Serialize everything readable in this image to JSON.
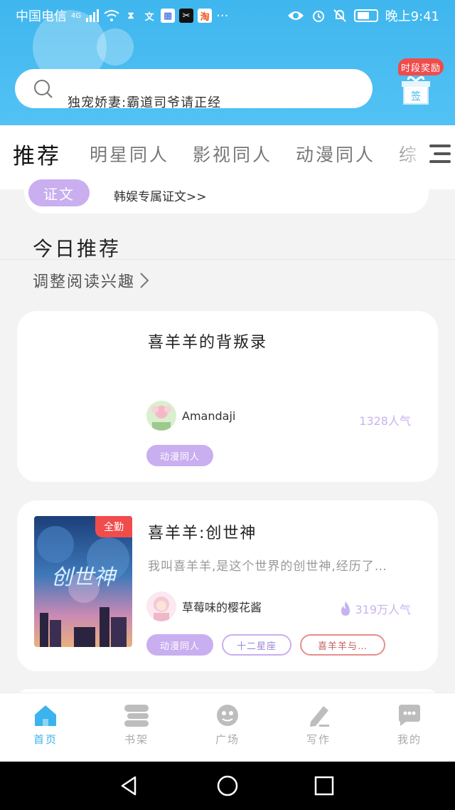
{
  "status_bar": {
    "carrier": "中国电信",
    "network": "4G",
    "time": "晚上9:41"
  },
  "search": {
    "placeholder": "独宠娇妻:霸道司爷请正经"
  },
  "reward": {
    "label": "时段奖励",
    "gift_text": "签"
  },
  "tabs": [
    {
      "label": "推荐",
      "active": true
    },
    {
      "label": "明星同人",
      "active": false
    },
    {
      "label": "影视同人",
      "active": false
    },
    {
      "label": "动漫同人",
      "active": false
    },
    {
      "label": "综",
      "active": false
    }
  ],
  "notice": {
    "pill": "证文",
    "text": "韩娱专属证文>>"
  },
  "section": {
    "title": "今日推荐",
    "interest_link": "调整阅读兴趣"
  },
  "books": [
    {
      "title": "喜羊羊的背叛录",
      "author": "Amandaji",
      "popularity": "1328人气",
      "tags": [
        "动漫同人"
      ]
    },
    {
      "title": "喜羊羊:创世神",
      "description": "我叫喜羊羊,是这个世界的创世神,经历了…",
      "author": "草莓味的樱花酱",
      "popularity": "319万人气",
      "cover_badge": "全勤",
      "cover_title": "创世神",
      "tags": [
        "动漫同人",
        "十二星座",
        "喜羊羊与…"
      ]
    }
  ],
  "bottom_nav": [
    {
      "label": "首页",
      "icon": "home-icon",
      "active": true
    },
    {
      "label": "书架",
      "icon": "bookshelf-icon",
      "active": false
    },
    {
      "label": "广场",
      "icon": "plaza-icon",
      "active": false
    },
    {
      "label": "写作",
      "icon": "pen-icon",
      "active": false
    },
    {
      "label": "我的",
      "icon": "chat-icon",
      "active": false
    }
  ],
  "colors": {
    "header_blue": "#3fb6ee",
    "accent_purple": "#c9aef0",
    "badge_red": "#f04c4c",
    "nav_active": "#3ab3ee"
  }
}
